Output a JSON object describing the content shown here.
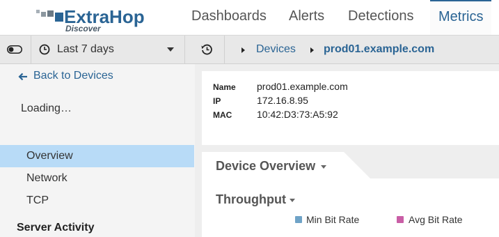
{
  "brand": {
    "name": "ExtraHop",
    "product": "Discover",
    "color": "#2a6494"
  },
  "nav": {
    "items": [
      {
        "label": "Dashboards"
      },
      {
        "label": "Alerts"
      },
      {
        "label": "Detections"
      },
      {
        "label": "Metrics",
        "active": true
      }
    ]
  },
  "toolbar": {
    "time_range": "Last 7 days",
    "breadcrumb": [
      {
        "label": "Devices"
      },
      {
        "label": "prod01.example.com"
      }
    ]
  },
  "sidebar": {
    "back_label": "Back to Devices",
    "loading_text": "Loading…",
    "items": [
      {
        "label": "Overview",
        "selected": true
      },
      {
        "label": "Network"
      },
      {
        "label": "TCP"
      }
    ],
    "section_heading": "Server Activity"
  },
  "device": {
    "fields": [
      {
        "key": "Name",
        "value": "prod01.example.com"
      },
      {
        "key": "IP",
        "value": "172.16.8.95"
      },
      {
        "key": "MAC",
        "value": "10:42:D3:73:A5:92"
      }
    ]
  },
  "panel": {
    "title": "Device Overview",
    "chart_title": "Throughput",
    "legend": [
      {
        "label": "Min Bit Rate",
        "color": "#6fa3c7"
      },
      {
        "label": "Avg Bit Rate",
        "color": "#c95ea6"
      }
    ]
  },
  "icons": {
    "toggle": "toggle-icon",
    "clock": "clock-icon",
    "history": "history-icon",
    "back": "arrow-left-icon"
  }
}
